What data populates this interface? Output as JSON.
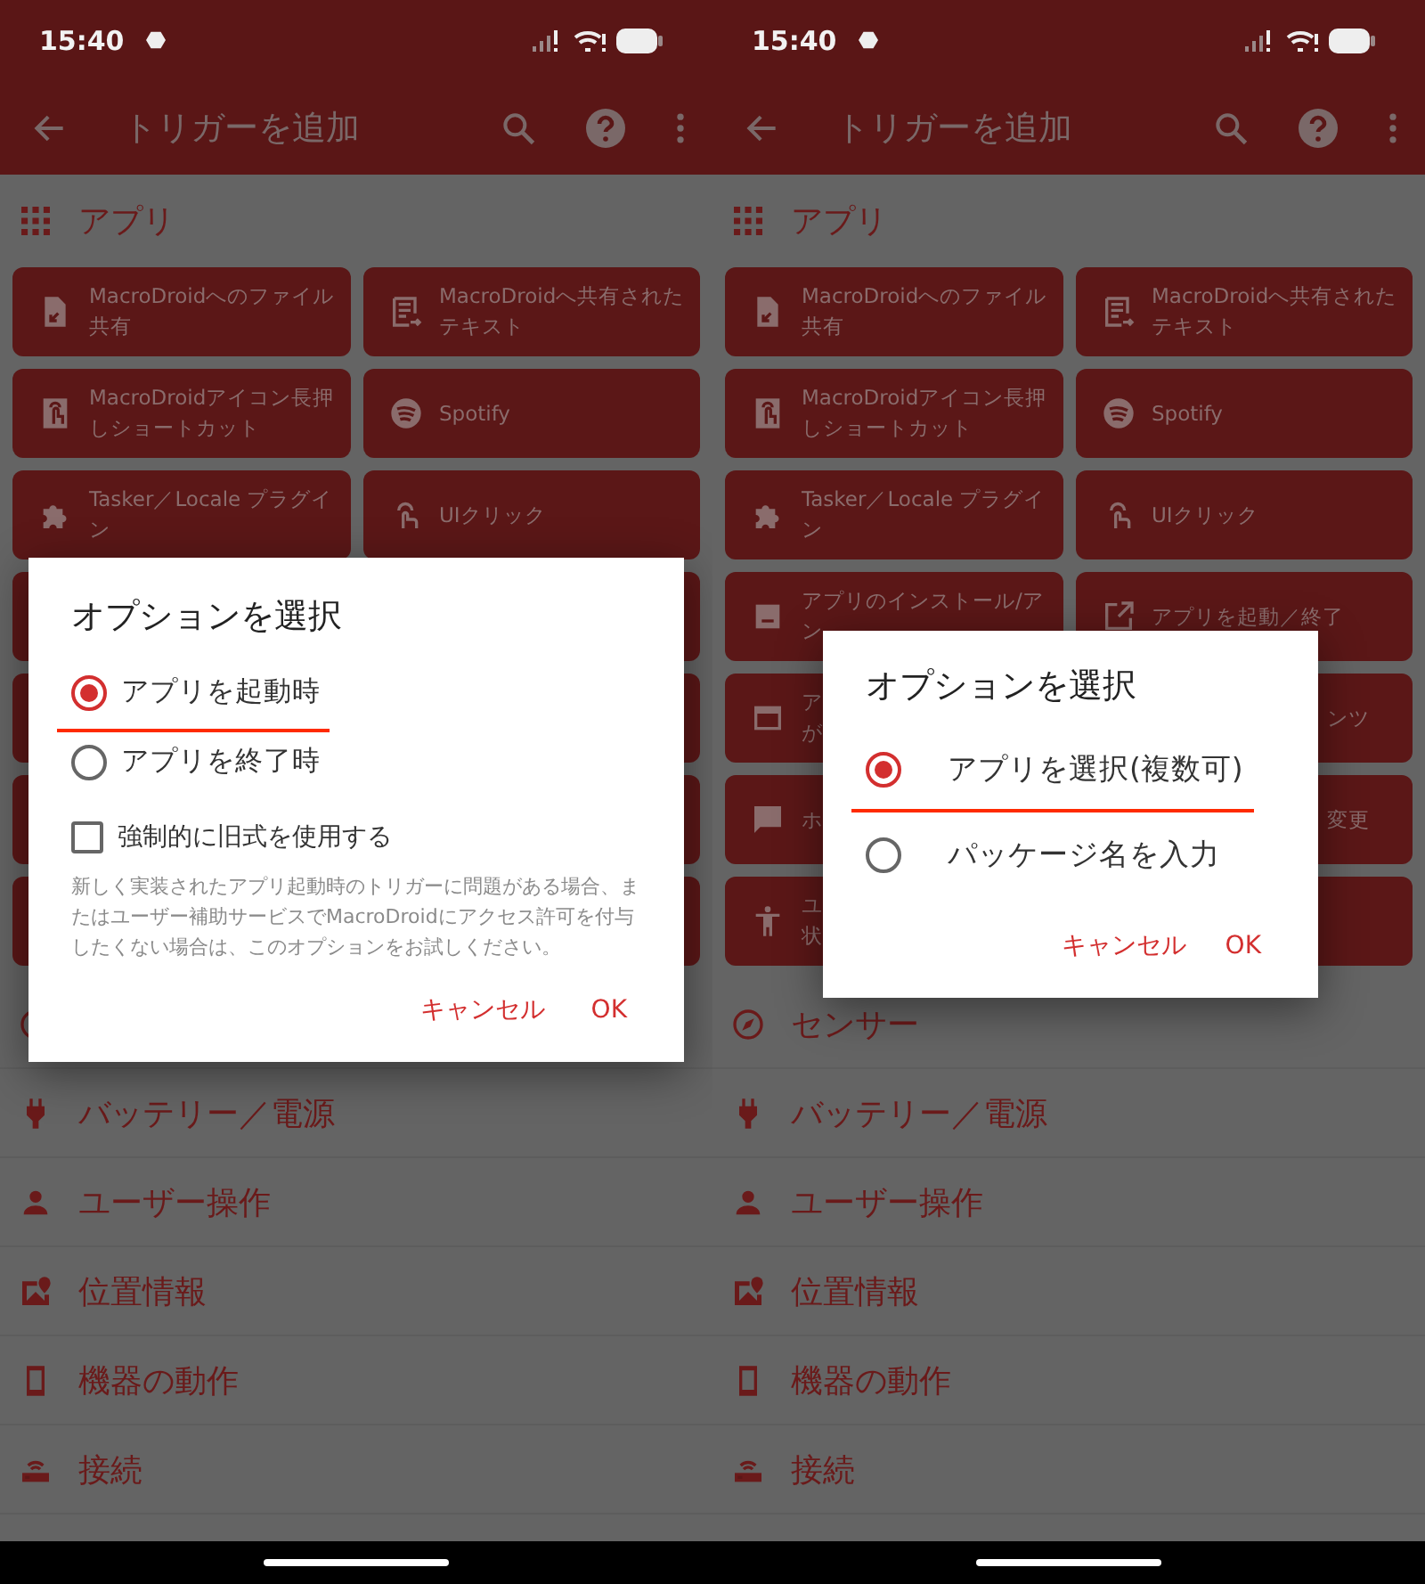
{
  "screens": [
    {
      "status_bar": {
        "time": "15:40"
      },
      "toolbar": {
        "title": "トリガーを追加"
      },
      "section": {
        "title": "アプリ"
      },
      "tiles": [
        {
          "kind": "file-share",
          "lines": [
            "MacroDroidへのファイル",
            "共有"
          ]
        },
        {
          "kind": "text-share",
          "lines": [
            "MacroDroidへ共有された",
            "テキスト"
          ]
        },
        {
          "kind": "touch-shortcut",
          "lines": [
            "MacroDroidアイコン長押",
            "しショートカット"
          ]
        },
        {
          "kind": "spotify",
          "lines": [
            "Spotify"
          ]
        },
        {
          "kind": "plugin",
          "lines": [
            "Tasker／Locale プラグイ",
            "ン"
          ]
        },
        {
          "kind": "ui-click",
          "lines": [
            "UIクリック"
          ]
        },
        {
          "kind": "blank"
        },
        {
          "kind": "blank"
        },
        {
          "kind": "blank"
        },
        {
          "kind": "blank"
        },
        {
          "kind": "blank"
        },
        {
          "kind": "blank"
        },
        {
          "kind": "blank"
        },
        {
          "kind": "blank"
        }
      ],
      "categories": [
        {
          "kind": "sensor"
        },
        {
          "kind": "battery",
          "label": "バッテリー／電源"
        },
        {
          "kind": "user",
          "label": "ユーザー操作"
        },
        {
          "kind": "location",
          "label": "位置情報"
        },
        {
          "kind": "device",
          "label": "機器の動作"
        },
        {
          "kind": "connection",
          "label": "接続"
        }
      ],
      "dialog": {
        "title": "オプションを選択",
        "options": [
          {
            "label": "アプリを起動時",
            "selected": true,
            "underlined": true
          },
          {
            "label": "アプリを終了時",
            "selected": false,
            "underlined": false
          }
        ],
        "checkbox": {
          "label": "強制的に旧式を使用する",
          "checked": false
        },
        "description": "新しく実装されたアプリ起動時のトリガーに問題がある場合、またはユーザー補助サービスでMacroDroidにアクセス許可を付与したくない場合は、このオプションをお試しください。",
        "buttons": [
          "キャンセル",
          "OK"
        ]
      }
    },
    {
      "status_bar": {
        "time": "15:40"
      },
      "toolbar": {
        "title": "トリガーを追加"
      },
      "section": {
        "title": "アプリ"
      },
      "tiles": [
        {
          "kind": "file-share",
          "lines": [
            "MacroDroidへのファイル",
            "共有"
          ]
        },
        {
          "kind": "text-share",
          "lines": [
            "MacroDroidへ共有された",
            "テキスト"
          ]
        },
        {
          "kind": "touch-shortcut",
          "lines": [
            "MacroDroidアイコン長押",
            "しショートカット"
          ]
        },
        {
          "kind": "spotify",
          "lines": [
            "Spotify"
          ]
        },
        {
          "kind": "plugin",
          "lines": [
            "Tasker／Locale プラグイ",
            "ン"
          ]
        },
        {
          "kind": "ui-click",
          "lines": [
            "UIクリック"
          ]
        },
        {
          "kind": "install",
          "lines": [
            "アプリのインストール/ア",
            "ン"
          ]
        },
        {
          "kind": "launch",
          "lines": [
            "アプリを起動／終了"
          ]
        },
        {
          "kind": "window",
          "lines": [
            "ア",
            "が"
          ]
        },
        {
          "kind": "blank",
          "tail": true,
          "lines": [
            "ンツ"
          ]
        },
        {
          "kind": "chat",
          "lines": [
            "ホ"
          ]
        },
        {
          "kind": "blank",
          "tail": true,
          "lines": [
            "変更"
          ]
        },
        {
          "kind": "accessibility",
          "lines": [
            "ユ",
            "状"
          ]
        },
        {
          "kind": "blank"
        }
      ],
      "categories": [
        {
          "kind": "sensor",
          "label": "センサー"
        },
        {
          "kind": "battery",
          "label": "バッテリー／電源"
        },
        {
          "kind": "user",
          "label": "ユーザー操作"
        },
        {
          "kind": "location",
          "label": "位置情報"
        },
        {
          "kind": "device",
          "label": "機器の動作"
        },
        {
          "kind": "connection",
          "label": "接続"
        }
      ],
      "dialog": {
        "title": "オプションを選択",
        "options": [
          {
            "label": "アプリを選択(複数可)",
            "selected": true,
            "underlined": true
          },
          {
            "label": "パッケージ名を入力",
            "selected": false,
            "underlined": false
          }
        ],
        "buttons": [
          "キャンセル",
          "OK"
        ]
      }
    }
  ]
}
